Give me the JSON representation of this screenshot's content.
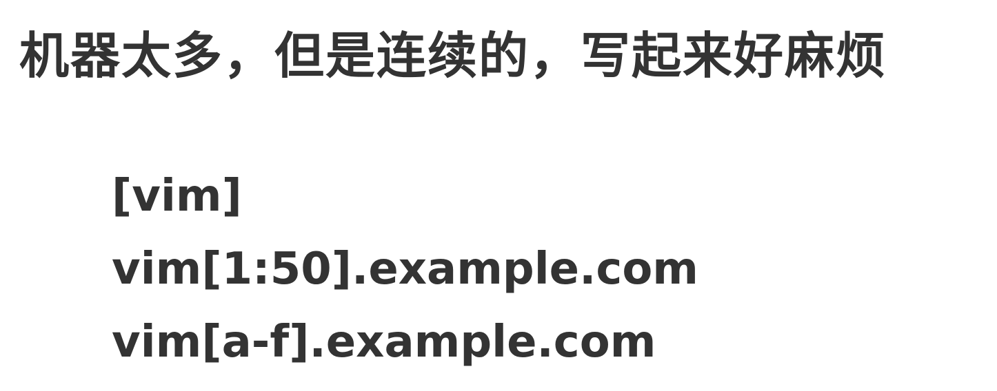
{
  "heading": "机器太多，但是连续的，写起来好麻烦",
  "code_lines": [
    "[vim]",
    "vim[1:50].example.com",
    "vim[a-f].example.com"
  ]
}
